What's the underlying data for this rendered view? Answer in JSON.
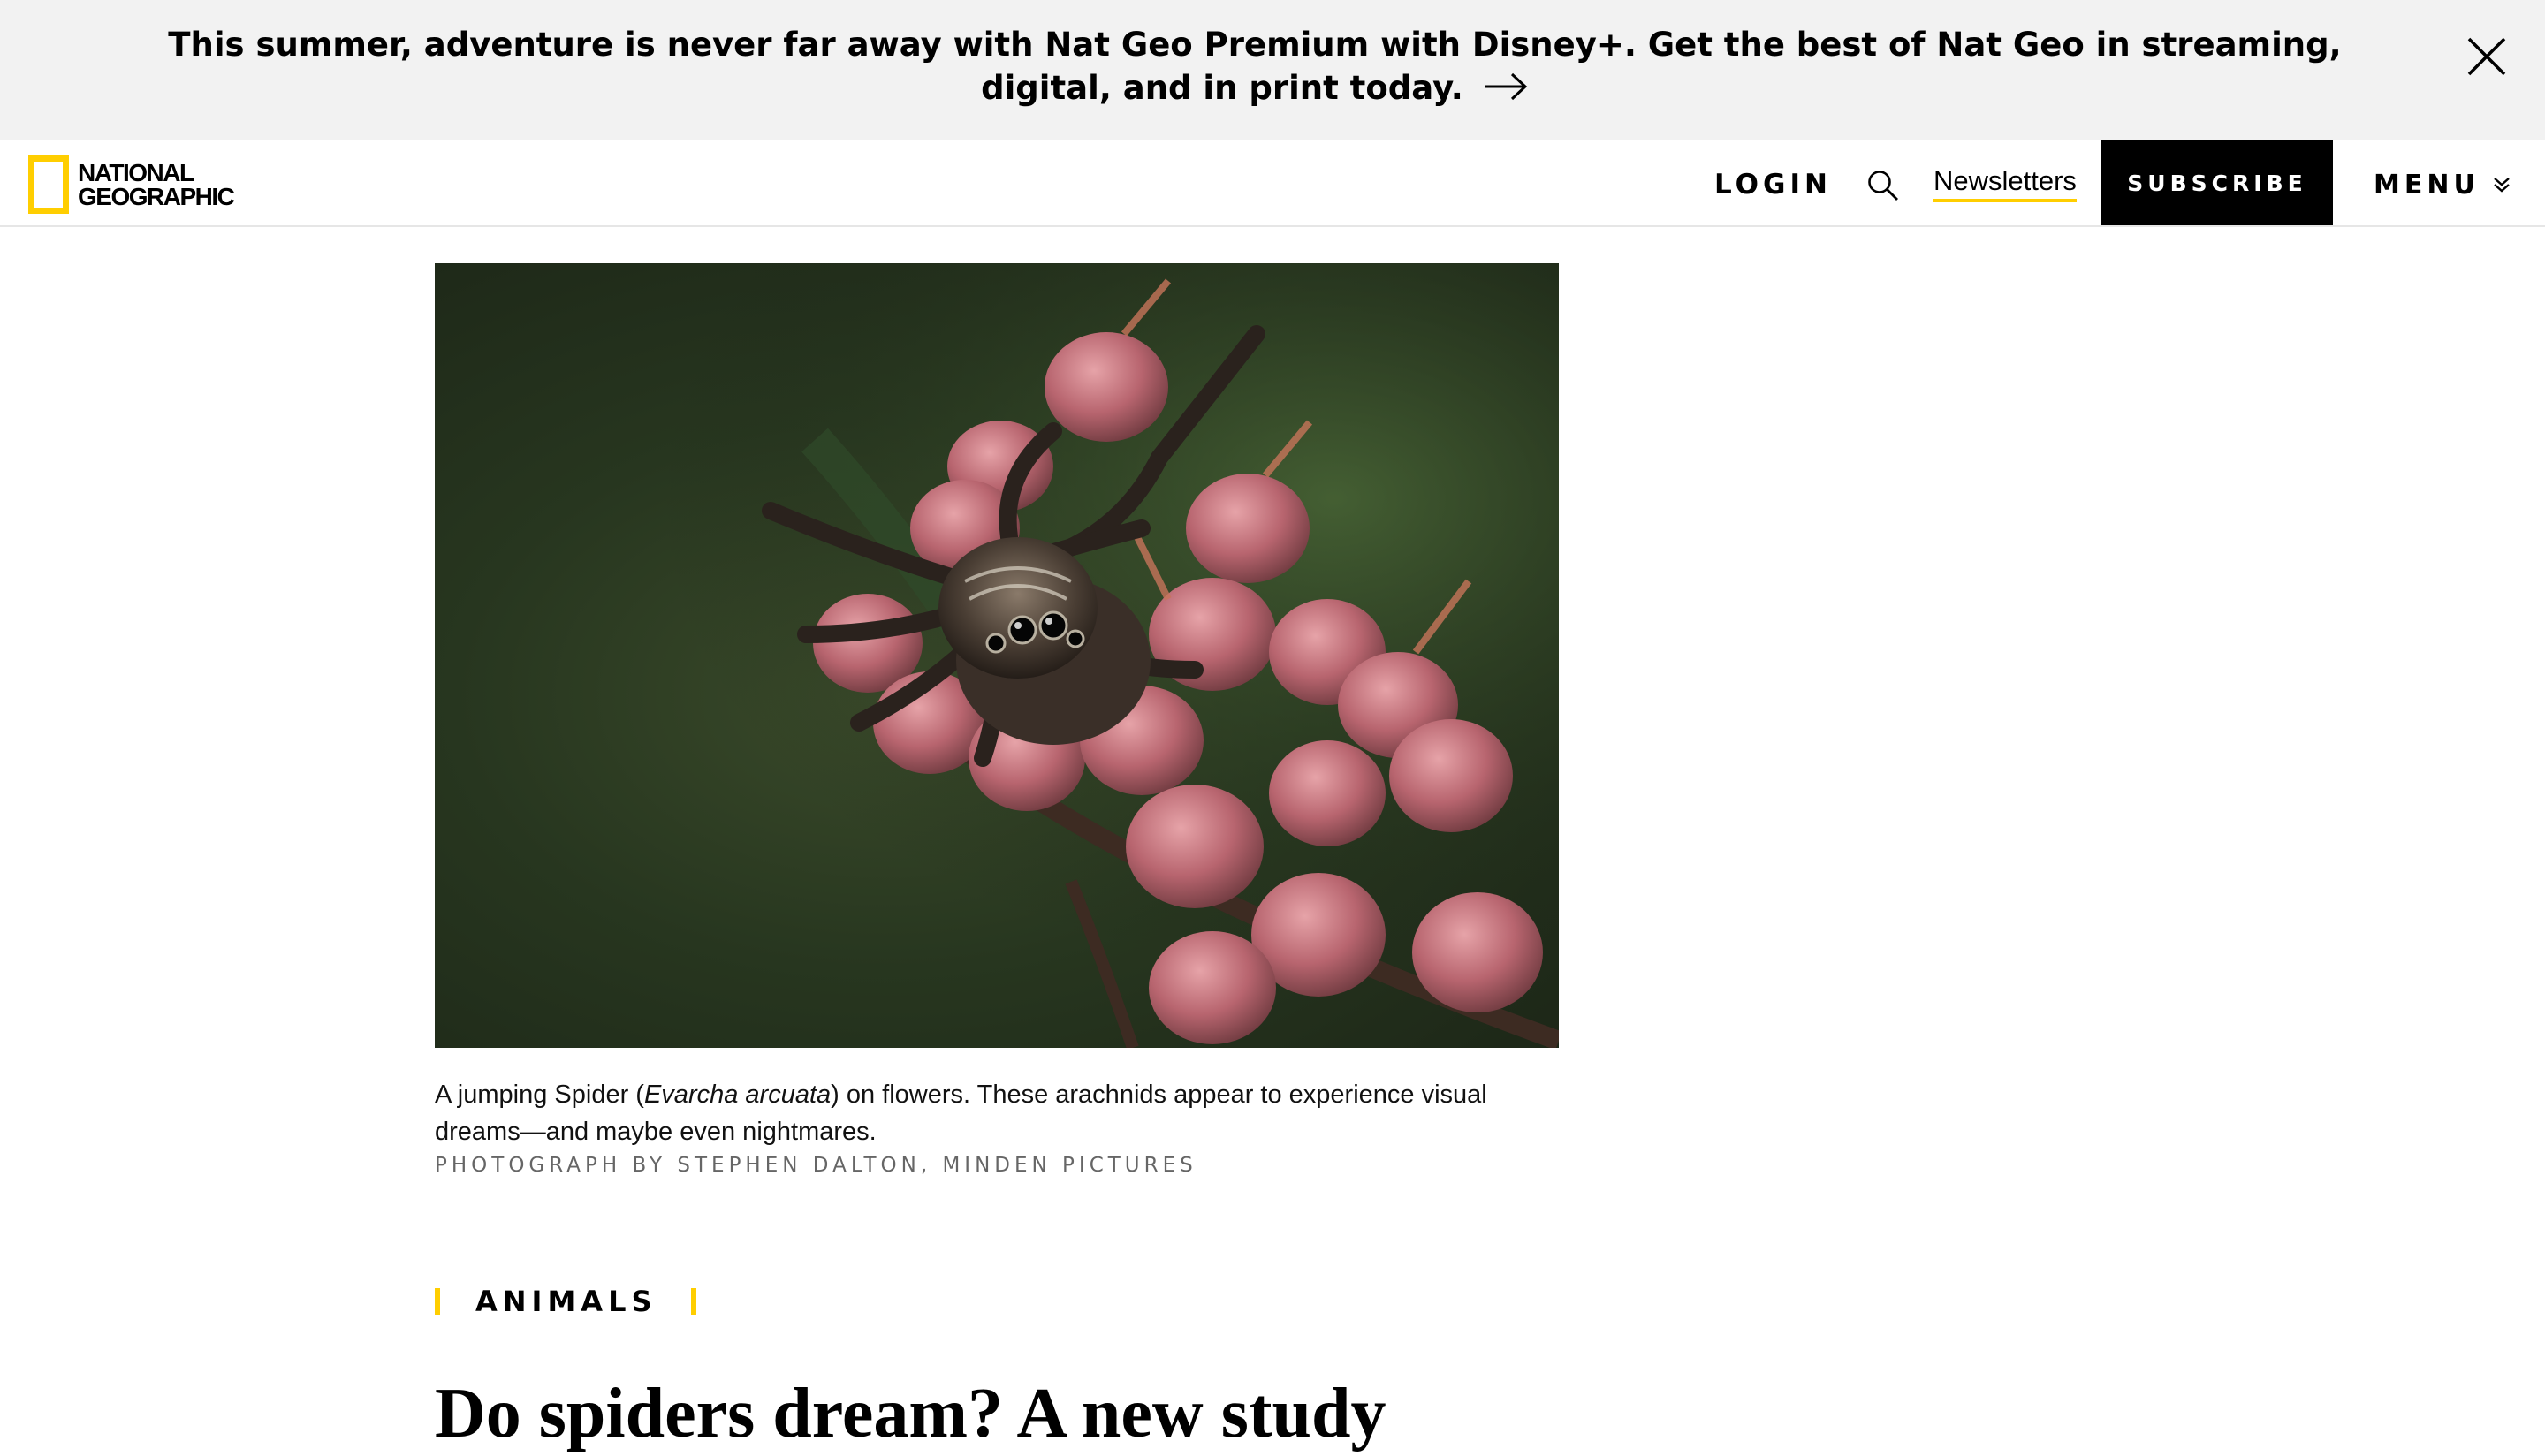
{
  "promo": {
    "text": "This summer, adventure is never far away with Nat Geo Premium with Disney+. Get the best of Nat Geo in streaming, digital, and in print today.",
    "arrow_icon": "arrow-right-icon",
    "close_icon": "close-icon"
  },
  "header": {
    "logo_text": "NATIONAL\nGEOGRAPHIC",
    "logo_color": "#ffce00",
    "login": "LOGIN",
    "search_icon": "search-icon",
    "newsletters": "Newsletters",
    "subscribe": "SUBSCRIBE",
    "menu": "MENU",
    "menu_icon": "chevron-down-icon"
  },
  "article": {
    "caption_before": "A jumping Spider (",
    "caption_italic": "Evarcha arcuata",
    "caption_after": ") on flowers. These arachnids appear to experience visual dreams—and maybe even nightmares.",
    "credit": "PHOTOGRAPH BY STEPHEN DALTON, MINDEN PICTURES",
    "section": "ANIMALS",
    "headline": "Do spiders dream? A new study"
  },
  "colors": {
    "accent": "#ffce00",
    "banner_bg": "#f2f2f2",
    "subscribe_bg": "#000000"
  }
}
